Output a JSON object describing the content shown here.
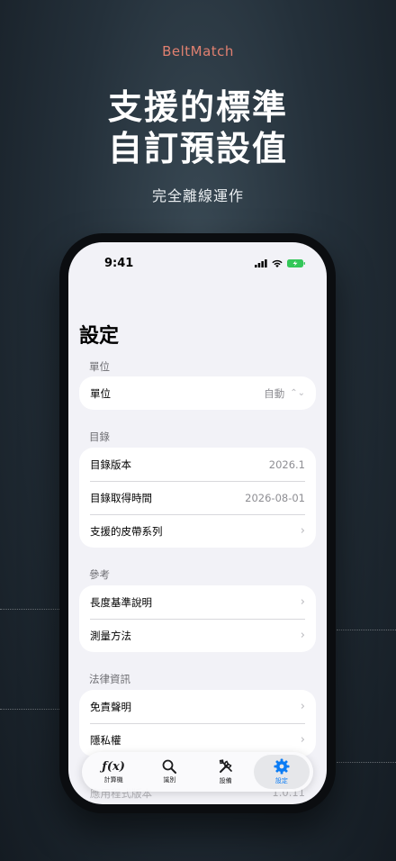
{
  "promo": {
    "brand": "BeltMatch",
    "headline_line1": "支援的標準",
    "headline_line2": "自訂預設值",
    "subline": "完全離線運作"
  },
  "status_bar": {
    "time": "9:41"
  },
  "settings": {
    "title": "設定",
    "units": {
      "header": "單位",
      "rows": [
        {
          "label": "單位",
          "value": "自動"
        }
      ]
    },
    "catalog": {
      "header": "目錄",
      "rows": [
        {
          "label": "目錄版本",
          "value": "2026.1"
        },
        {
          "label": "目錄取得時間",
          "value": "2026-08-01"
        },
        {
          "label": "支援的皮帶系列"
        }
      ]
    },
    "reference": {
      "header": "參考",
      "rows": [
        {
          "label": "長度基準說明"
        },
        {
          "label": "測量方法"
        }
      ]
    },
    "legal": {
      "header": "法律資訊",
      "rows": [
        {
          "label": "免責聲明"
        },
        {
          "label": "隱私權"
        }
      ]
    },
    "app_version": {
      "label": "應用程式版本",
      "value": "1.0.11"
    }
  },
  "tabbar": {
    "tabs": [
      {
        "label": "計算機",
        "icon": "function-icon"
      },
      {
        "label": "識別",
        "icon": "magnifier-icon"
      },
      {
        "label": "設備",
        "icon": "tools-icon"
      },
      {
        "label": "設定",
        "icon": "gear-icon",
        "active": true
      }
    ]
  },
  "colors": {
    "accent": "#0a7cf5",
    "brand": "#e08070",
    "battery": "#34c759"
  }
}
